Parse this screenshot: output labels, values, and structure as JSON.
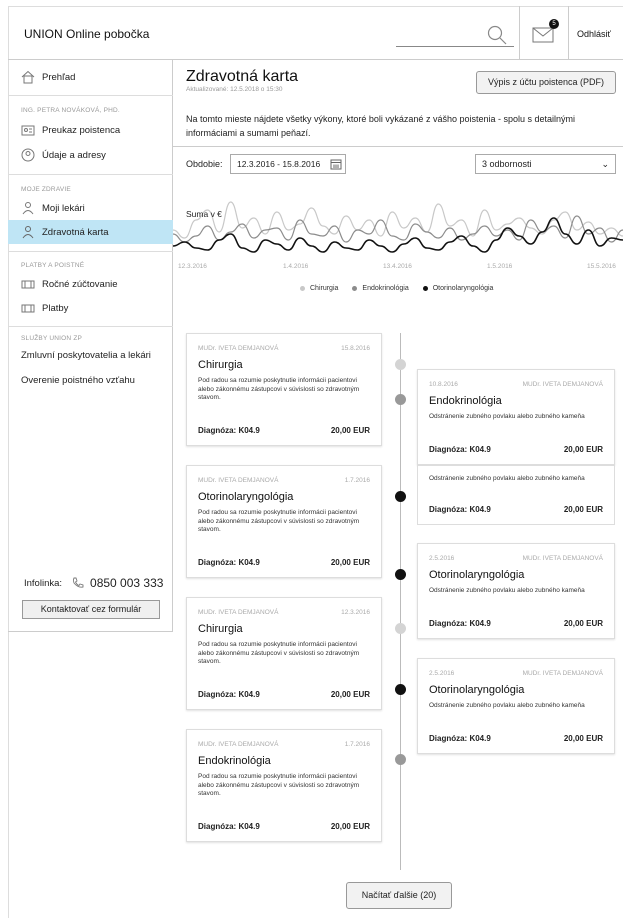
{
  "header": {
    "app_title": "UNION Online pobočka",
    "mail_badge": "5",
    "logout_label": "Odhlásiť"
  },
  "sidebar": {
    "overview_label": "Prehľad",
    "user_group": "ING. PETRA NOVÁKOVÁ, PHD.",
    "user_items": [
      "Preukaz poistenca",
      "Údaje a adresy"
    ],
    "health_group": "MOJE ZDRAVIE",
    "health_items": [
      "Moji lekári",
      "Zdravotná karta"
    ],
    "payments_group": "PLATBY A POISTNÉ",
    "payments_items": [
      "Ročné zúčtovanie",
      "Platby"
    ],
    "services_group": "SLUŽBY UNION ZP",
    "services_items": [
      "Zmluvní poskytovatelia a lekári",
      "Overenie poistného vzťahu"
    ],
    "infoline_label": "Infolinka:",
    "infoline_phone": "0850 003 333",
    "contact_button": "Kontaktovať cez formulár"
  },
  "main": {
    "title": "Zdravotná karta",
    "updated": "Aktualizované: 12.5.2018 o 15:30",
    "pdf_button": "Výpis z účtu poistenca (PDF)",
    "intro": "Na tomto mieste nájdete všetky výkony, ktoré boli vykázané z vášho poistenia - spolu s detailnými informáciami a sumami peňazí.",
    "period_label": "Obdobie:",
    "period_value": "12.3.2016 - 15.8.2016",
    "specialties_value": "3 odbornosti",
    "load_more_button": "Načítať ďalšie (20)"
  },
  "chart_data": {
    "type": "line",
    "ylabel": "Suma v €",
    "x_ticks": [
      "12.3.2016",
      "1.4.2016",
      "13.4.2016",
      "1.5.2016",
      "15.5.2016"
    ],
    "series": [
      {
        "name": "Chirurgia",
        "color": "#c8c8c8"
      },
      {
        "name": "Endokrinológia",
        "color": "#8c8c8c"
      },
      {
        "name": "Otorinolaryngológia",
        "color": "#111111"
      }
    ]
  },
  "timeline": {
    "left_cards": [
      {
        "doctor": "MUDr. IVETA DEMJANOVÁ",
        "date": "15.8.2016",
        "specialty": "Chirurgia",
        "description": "Pod radou sa rozumie poskytnutie informácii pacientovi alebo zákonnému zástupcovi v súvislosti so zdravotným stavom.",
        "diagnosis": "Diagnóza: K04.9",
        "amount": "20,00 EUR"
      },
      {
        "doctor": "MUDr. IVETA DEMJANOVÁ",
        "date": "1.7.2016",
        "specialty": "Otorinolaryngológia",
        "description": "Pod radou sa rozumie poskytnutie informácii pacientovi alebo zákonnému zástupcovi v súvislosti so zdravotným stavom.",
        "diagnosis": "Diagnóza: K04.9",
        "amount": "20,00 EUR"
      },
      {
        "doctor": "MUDr. IVETA DEMJANOVÁ",
        "date": "12.3.2016",
        "specialty": "Chirurgia",
        "description": "Pod radou sa rozumie poskytnutie informácii pacientovi alebo zákonnému zástupcovi v súvislosti so zdravotným stavom.",
        "diagnosis": "Diagnóza: K04.9",
        "amount": "20,00 EUR"
      },
      {
        "doctor": "MUDr. IVETA DEMJANOVÁ",
        "date": "1.7.2016",
        "specialty": "Endokrinológia",
        "description": "Pod radou sa rozumie poskytnutie informácii pacientovi alebo zákonnému zástupcovi v súvislosti so zdravotným stavom.",
        "diagnosis": "Diagnóza: K04.9",
        "amount": "20,00 EUR"
      }
    ],
    "right_cards": [
      {
        "date": "10.8.2016",
        "doctor": "MUDr. IVETA DEMJANOVÁ",
        "specialty": "Endokrinológia",
        "description": "Odstránenie zubného povlaku alebo zubného kameňa",
        "diagnosis": "Diagnóza: K04.9",
        "amount": "20,00 EUR"
      },
      {
        "description": "Odstránenie zubného povlaku alebo zubného kameňa",
        "diagnosis": "Diagnóza: K04.9",
        "amount": "20,00 EUR"
      },
      {
        "date": "2.5.2016",
        "doctor": "MUDr. IVETA DEMJANOVÁ",
        "specialty": "Otorinolaryngológia",
        "description": "Odstránenie zubného povlaku alebo zubného kameňa",
        "diagnosis": "Diagnóza: K04.9",
        "amount": "20,00 EUR"
      },
      {
        "date": "2.5.2016",
        "doctor": "MUDr. IVETA DEMJANOVÁ",
        "specialty": "Otorinolaryngológia",
        "description": "Odstránenie zubného povlaku alebo zubného kameňa",
        "diagnosis": "Diagnóza: K04.9",
        "amount": "20,00 EUR"
      }
    ],
    "dot_colors": {
      "light": "#d4d4d4",
      "mid": "#999999",
      "dark": "#111111"
    }
  }
}
